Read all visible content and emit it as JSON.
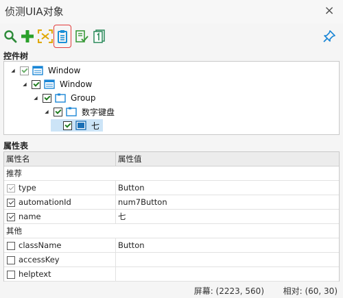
{
  "window": {
    "title": "侦测UIA对象",
    "close_glyph": "×"
  },
  "toolbar": {
    "buttons": [
      {
        "name": "search-icon",
        "color": "#2e8b3a"
      },
      {
        "name": "add-icon",
        "color": "#2aa02a"
      },
      {
        "name": "capture-icon",
        "color": "#e0a800"
      },
      {
        "name": "clipboard-icon",
        "color": "#1a8fd6",
        "selected": true
      },
      {
        "name": "list-check-icon",
        "color": "#3a9a3a"
      },
      {
        "name": "page-one-icon",
        "color": "#2a8a5a"
      },
      {
        "name": "pin-icon",
        "color": "#1a86d6"
      }
    ]
  },
  "tree": {
    "label": "控件树",
    "nodes": [
      {
        "label": "Window",
        "checked": true,
        "grey": true,
        "icon": "window-icon"
      },
      {
        "label": "Window",
        "checked": true,
        "icon": "window-icon"
      },
      {
        "label": "Group",
        "checked": true,
        "icon": "group-icon"
      },
      {
        "label": "数字键盘",
        "checked": true,
        "icon": "group-icon"
      },
      {
        "label": "七",
        "checked": true,
        "icon": "button-icon",
        "selected": true
      }
    ]
  },
  "props": {
    "label": "属性表",
    "headers": {
      "name": "属性名",
      "value": "属性值"
    },
    "group_recommended": "推荐",
    "group_other": "其他",
    "rows_recommended": [
      {
        "name": "type",
        "value": "Button",
        "checked": true,
        "grey": true
      },
      {
        "name": "automationId",
        "value": "num7Button",
        "checked": true
      },
      {
        "name": "name",
        "value": "七",
        "checked": true
      }
    ],
    "rows_other": [
      {
        "name": "className",
        "value": "Button",
        "checked": false
      },
      {
        "name": "accessKey",
        "value": "",
        "checked": false
      },
      {
        "name": "helptext",
        "value": "",
        "checked": false
      }
    ]
  },
  "status": {
    "screen": "屏幕: (2223, 560)",
    "relative": "相对: (60, 30)"
  },
  "colors": {
    "accent_blue": "#1a86d6",
    "selected_row": "#cce4f7",
    "highlight_border": "#e23b3b"
  }
}
